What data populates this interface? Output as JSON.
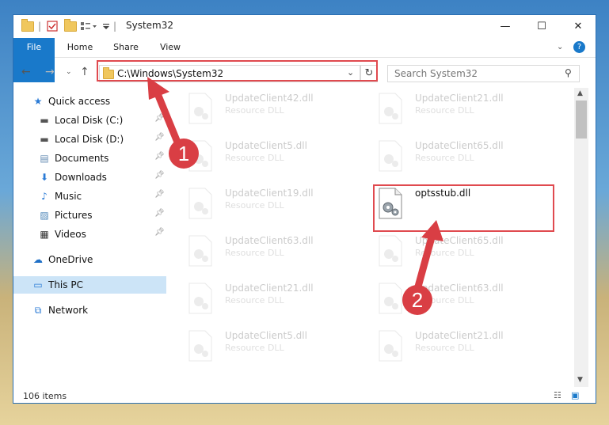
{
  "window": {
    "title": "System32",
    "minimize": "—",
    "maximize": "☐",
    "close": "✕",
    "help": "?"
  },
  "ribbon": {
    "tabs": [
      "File",
      "Home",
      "Share",
      "View"
    ]
  },
  "address": {
    "path": "C:\\Windows\\System32",
    "search_placeholder": "Search System32"
  },
  "nav": {
    "quick_access": "Quick access",
    "items": [
      "Local Disk (C:)",
      "Local Disk (D:)",
      "Documents",
      "Downloads",
      "Music",
      "Pictures",
      "Videos"
    ],
    "onedrive": "OneDrive",
    "this_pc": "This PC",
    "network": "Network"
  },
  "files": [
    {
      "name": "UpdateClient42.dll",
      "type": "Resource DLL"
    },
    {
      "name": "UpdateClient21.dll",
      "type": "Resource DLL"
    },
    {
      "name": "UpdateClient5.dll",
      "type": "Resource DLL"
    },
    {
      "name": "UpdateClient65.dll",
      "type": "Resource DLL"
    },
    {
      "name": "UpdateClient19.dll",
      "type": "Resource DLL"
    },
    {
      "name": "optsstub.dll",
      "type": ""
    },
    {
      "name": "UpdateClient63.dll",
      "type": "Resource DLL"
    },
    {
      "name": "UpdateClient65.dll",
      "type": "Resource DLL"
    },
    {
      "name": "UpdateClient21.dll",
      "type": "Resource DLL"
    },
    {
      "name": "UpdateClient63.dll",
      "type": "Resource DLL"
    },
    {
      "name": "UpdateClient5.dll",
      "type": "Resource DLL"
    },
    {
      "name": "UpdateClient21.dll",
      "type": "Resource DLL"
    }
  ],
  "status": {
    "count": "106 items"
  },
  "annotations": {
    "step1": "1",
    "step2": "2",
    "color": "#d93e44"
  }
}
